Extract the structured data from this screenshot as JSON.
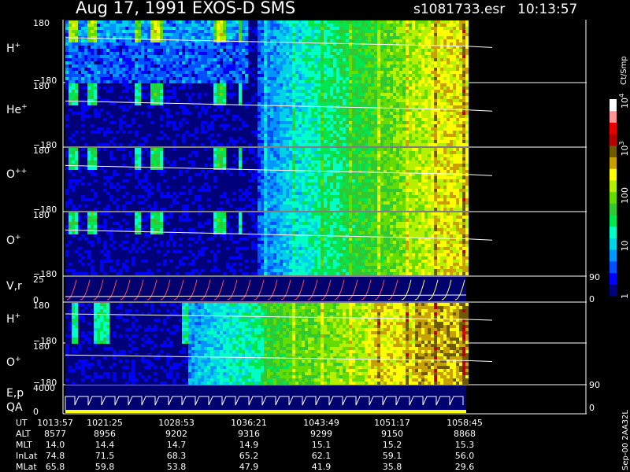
{
  "header": {
    "title": "Aug 17, 1991   EXOS-D SMS",
    "file": "s1081733.esr",
    "time": "10:13:57"
  },
  "colorbar": {
    "unit": "Ct/Smp",
    "ticks": [
      {
        "label": "1",
        "value": 1
      },
      {
        "label": "10",
        "value": 10
      },
      {
        "label": "100",
        "value": 100
      },
      {
        "label": "10",
        "sup": "3",
        "value": 1000
      },
      {
        "label": "10",
        "sup": "4",
        "value": 10000
      }
    ],
    "colors": [
      "#00007a",
      "#0000ff",
      "#0050ff",
      "#0096ff",
      "#00d2e6",
      "#00ffc8",
      "#00e650",
      "#32c832",
      "#64dc00",
      "#b4f000",
      "#ffff00",
      "#c8a000",
      "#6e5a00",
      "#b40000",
      "#e60000",
      "#ff9696",
      "#ffffff"
    ]
  },
  "side_scale": {
    "upper": "90",
    "lower": "0"
  },
  "footer_id": "Sep-00  2AA32L",
  "chart_data": {
    "type": "heatmap",
    "x_ticks": [
      "1013:57",
      "1021:25",
      "1028:53",
      "1036:21",
      "1043:49",
      "1051:17",
      "1058:45"
    ],
    "panels": [
      {
        "key": "h_plus",
        "label": "H",
        "sup": "+",
        "ymax": "180",
        "ymin": "−180",
        "profile": "topA"
      },
      {
        "key": "he_plus",
        "label": "He",
        "sup": "+",
        "ymax": "180",
        "ymin": "−180",
        "profile": "topB"
      },
      {
        "key": "o_pp",
        "label": "O",
        "sup": "++",
        "ymax": "180",
        "ymin": "−180",
        "profile": "topC"
      },
      {
        "key": "o_plus",
        "label": "O",
        "sup": "+",
        "ymax": "180",
        "ymin": "−180",
        "profile": "topD"
      },
      {
        "key": "vr",
        "label": "V,r",
        "ymax": "25",
        "ymin": "0",
        "kind": "line"
      },
      {
        "key": "h_plus_2",
        "label": "H",
        "sup": "+",
        "ymax": "180",
        "ymin": "−180",
        "profile": "botA"
      },
      {
        "key": "o_plus_2",
        "label": "O",
        "sup": "+",
        "ymax": "180",
        "ymin": "−180",
        "profile": "botB"
      },
      {
        "key": "ep",
        "label": "E,p",
        "label2": "QA",
        "ymax": "4000",
        "ymin": "0",
        "kind": "steps"
      }
    ],
    "ephemeris": {
      "rows": [
        {
          "label": "UT",
          "values": [
            "1013:57",
            "1021:25",
            "1028:53",
            "1036:21",
            "1043:49",
            "1051:17",
            "1058:45"
          ]
        },
        {
          "label": "ALT",
          "values": [
            "8577",
            "8956",
            "9202",
            "9316",
            "9299",
            "9150",
            "8868"
          ]
        },
        {
          "label": "MLT",
          "values": [
            "14.0",
            "14.4",
            "14.7",
            "14.9",
            "15.1",
            "15.2",
            "15.3"
          ]
        },
        {
          "label": "InLat",
          "values": [
            "74.8",
            "71.5",
            "68.3",
            "65.2",
            "62.1",
            "59.1",
            "56.0"
          ]
        },
        {
          "label": "MLat",
          "values": [
            "65.8",
            "59.8",
            "53.8",
            "47.9",
            "41.9",
            "35.8",
            "29.6"
          ]
        }
      ]
    }
  }
}
